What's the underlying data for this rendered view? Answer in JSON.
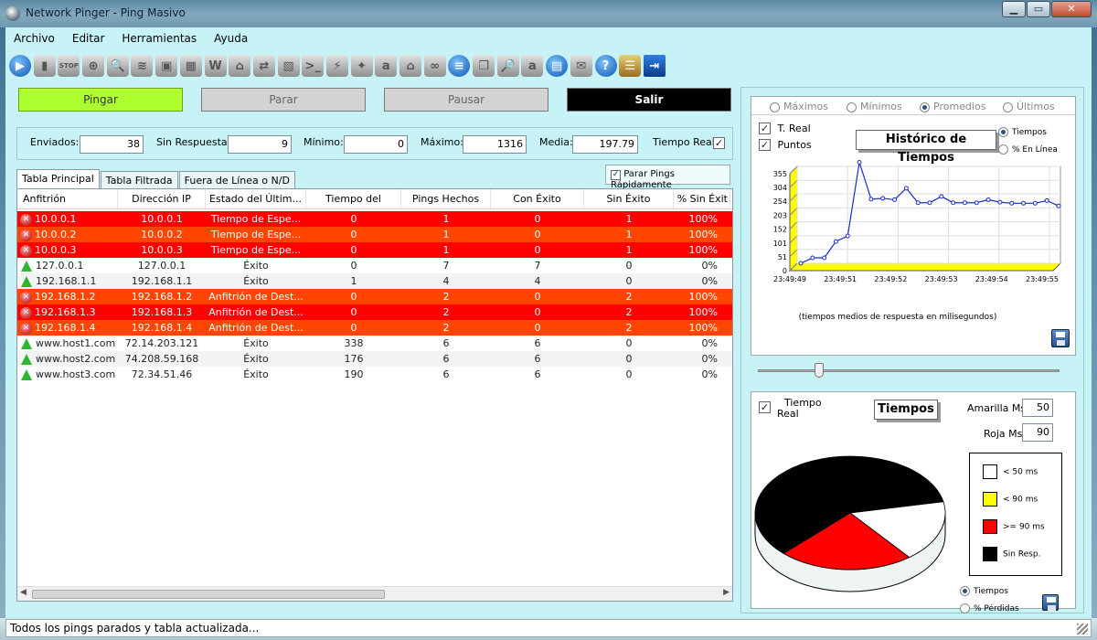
{
  "window": {
    "title": "Network Pinger - Ping Masivo",
    "min": "▁",
    "max": "▭",
    "close": "✕"
  },
  "menu": [
    "Archivo",
    "Editar",
    "Herramientas",
    "Ayuda"
  ],
  "toolbar": [
    {
      "name": "play-icon",
      "style": "blue",
      "glyph": "▶"
    },
    {
      "name": "phone-icon",
      "style": "grey",
      "glyph": "▮"
    },
    {
      "name": "stop-icon",
      "style": "grey",
      "glyph": "STOP"
    },
    {
      "name": "target-icon",
      "style": "grey",
      "glyph": "⊕"
    },
    {
      "name": "magnifier-icon",
      "style": "grey",
      "glyph": "🔍"
    },
    {
      "name": "ip-scan-icon",
      "style": "grey",
      "glyph": "≋"
    },
    {
      "name": "picture-icon",
      "style": "grey",
      "glyph": "▣"
    },
    {
      "name": "grid-icon",
      "style": "grey",
      "glyph": "▦"
    },
    {
      "name": "wifi-icon",
      "style": "grey",
      "glyph": "W"
    },
    {
      "name": "factory-icon",
      "style": "grey",
      "glyph": "⌂"
    },
    {
      "name": "network-icon",
      "style": "grey",
      "glyph": "⇄"
    },
    {
      "name": "map-icon",
      "style": "grey",
      "glyph": "▧"
    },
    {
      "name": "terminal-icon",
      "style": "grey",
      "glyph": ">_"
    },
    {
      "name": "cable-icon",
      "style": "grey",
      "glyph": "⚡"
    },
    {
      "name": "flashlight-icon",
      "style": "grey",
      "glyph": "✦"
    },
    {
      "name": "amazon-icon",
      "style": "grey",
      "glyph": "a"
    },
    {
      "name": "bank-icon",
      "style": "grey",
      "glyph": "⌂"
    },
    {
      "name": "link-icon",
      "style": "grey",
      "glyph": "∞"
    },
    {
      "name": "server-icon",
      "style": "blue",
      "glyph": "≡"
    },
    {
      "name": "copy-icon",
      "style": "grey",
      "glyph": "❐"
    },
    {
      "name": "search-doc-icon",
      "style": "grey",
      "glyph": "🔎"
    },
    {
      "name": "font-icon",
      "style": "grey",
      "glyph": "a"
    },
    {
      "name": "save-icon",
      "style": "blue",
      "glyph": "▤"
    },
    {
      "name": "mailbox-icon",
      "style": "grey",
      "glyph": "✉"
    },
    {
      "name": "help-icon",
      "style": "blue",
      "glyph": "?"
    },
    {
      "name": "notes-icon",
      "style": "note",
      "glyph": "☰"
    },
    {
      "name": "exit-door-icon",
      "style": "door",
      "glyph": "⇥"
    }
  ],
  "buttons": {
    "ping": "Pingar",
    "stop": "Parar",
    "pause": "Pausar",
    "exit": "Salir"
  },
  "stats": {
    "sent_label": "Enviados:",
    "sent": "38",
    "noresp_label": "Sin Respuesta:",
    "noresp": "9",
    "min_label": "Mínimo:",
    "min": "0",
    "max_label": "Máximo:",
    "max": "1316",
    "avg_label": "Media:",
    "avg": "197.79",
    "realtime_label": "Tiempo Real"
  },
  "tabs": [
    "Tabla Principal",
    "Tabla Filtrada",
    "Fuera de Línea o N/D"
  ],
  "fast_stop_label": "Parar Pings Rápidamente",
  "table": {
    "headers": [
      "Anfitrión",
      "Dirección IP",
      "Estado del Últim...",
      "Tiempo del Últim...",
      "Pings Hechos",
      "Con Éxito",
      "Sin Éxito",
      "% Sin Éxit"
    ],
    "rows": [
      {
        "style": "red",
        "icon": "err",
        "host": "10.0.0.1",
        "ip": "10.0.0.1",
        "status": "Tiempo de Espe...",
        "time": "0",
        "done": "1",
        "ok": "0",
        "fail": "1",
        "pct": "100%"
      },
      {
        "style": "orange",
        "icon": "err",
        "host": "10.0.0.2",
        "ip": "10.0.0.2",
        "status": "Tiempo de Espe...",
        "time": "0",
        "done": "1",
        "ok": "0",
        "fail": "1",
        "pct": "100%"
      },
      {
        "style": "red",
        "icon": "err",
        "host": "10.0.0.3",
        "ip": "10.0.0.3",
        "status": "Tiempo de Espe...",
        "time": "0",
        "done": "1",
        "ok": "0",
        "fail": "1",
        "pct": "100%"
      },
      {
        "style": "white",
        "icon": "ok",
        "host": "127.0.0.1",
        "ip": "127.0.0.1",
        "status": "Éxito",
        "time": "0",
        "done": "7",
        "ok": "7",
        "fail": "0",
        "pct": "0%"
      },
      {
        "style": "alt",
        "icon": "ok",
        "host": "192.168.1.1",
        "ip": "192.168.1.1",
        "status": "Éxito",
        "time": "1",
        "done": "4",
        "ok": "4",
        "fail": "0",
        "pct": "0%"
      },
      {
        "style": "orange",
        "icon": "err",
        "host": "192.168.1.2",
        "ip": "192.168.1.2",
        "status": "Anfitrión de Dest...",
        "time": "0",
        "done": "2",
        "ok": "0",
        "fail": "2",
        "pct": "100%"
      },
      {
        "style": "red",
        "icon": "err",
        "host": "192.168.1.3",
        "ip": "192.168.1.3",
        "status": "Anfitrión de Dest...",
        "time": "0",
        "done": "2",
        "ok": "0",
        "fail": "2",
        "pct": "100%"
      },
      {
        "style": "orange",
        "icon": "err",
        "host": "192.168.1.4",
        "ip": "192.168.1.4",
        "status": "Anfitrión de Dest...",
        "time": "0",
        "done": "2",
        "ok": "0",
        "fail": "2",
        "pct": "100%"
      },
      {
        "style": "white",
        "icon": "ok",
        "host": "www.host1.com",
        "ip": "72.14.203.121",
        "status": "Éxito",
        "time": "338",
        "done": "6",
        "ok": "6",
        "fail": "0",
        "pct": "0%"
      },
      {
        "style": "alt",
        "icon": "ok",
        "host": "www.host2.com",
        "ip": "74.208.59.168",
        "status": "Éxito",
        "time": "176",
        "done": "6",
        "ok": "6",
        "fail": "0",
        "pct": "0%"
      },
      {
        "style": "white",
        "icon": "ok",
        "host": "www.host3.com",
        "ip": "72.34.51.46",
        "status": "Éxito",
        "time": "190",
        "done": "6",
        "ok": "6",
        "fail": "0",
        "pct": "0%"
      }
    ]
  },
  "history": {
    "radios": [
      "Máximos",
      "Mínimos",
      "Promedios",
      "Últimos"
    ],
    "selected_radio": "Promedios",
    "treal_label": "T. Real",
    "points_label": "Puntos",
    "title": "Histórico de Tiempos",
    "mode_radios": [
      "Tiempos",
      "% En Línea"
    ],
    "selected_mode": "Tiempos",
    "caption": "(tiempos medios de respuesta en milisegundos)"
  },
  "pie": {
    "realtime_label_1": "Tiempo",
    "realtime_label_2": "Real",
    "title": "Tiempos",
    "yellow_label": "Amarilla Ms",
    "yellow_value": "50",
    "red_label": "Roja Ms",
    "red_value": "90",
    "legend": [
      {
        "label": "< 50 ms",
        "color": "#ffffff"
      },
      {
        "label": "< 90 ms",
        "color": "#ffff00"
      },
      {
        "label": ">= 90 ms",
        "color": "#ff0000"
      },
      {
        "label": "Sin Resp.",
        "color": "#000000"
      }
    ],
    "mode_radios": [
      "Tiempos",
      "% Pérdidas"
    ],
    "selected_mode": "Tiempos"
  },
  "chart_data": [
    {
      "type": "line",
      "title": "Histórico de Tiempos",
      "xlabel": "(tiempos medios de respuesta en milisegundos)",
      "ylabel": "",
      "yticks": [
        0,
        51,
        101,
        152,
        203,
        254,
        304,
        355
      ],
      "ylim": [
        0,
        355
      ],
      "xtick_labels": [
        "23:49:49",
        "23:49:51",
        "23:49:52",
        "23:49:53",
        "23:49:54",
        "23:49:55"
      ],
      "series": [
        {
          "values": [
            0,
            20,
            20,
            80,
            100,
            370,
            235,
            238,
            233,
            275,
            222,
            222,
            245,
            222,
            222,
            222,
            233,
            224,
            220,
            220,
            220,
            230,
            210
          ],
          "color": "#1a2cc8"
        }
      ]
    },
    {
      "type": "pie",
      "title": "Tiempos",
      "labels": [
        "< 50 ms",
        "< 90 ms",
        ">= 90 ms",
        "Sin Resp."
      ],
      "values": [
        17.5,
        0,
        23.0,
        59.5
      ],
      "colors": [
        "#ffffff",
        "#ffff00",
        "#ff0000",
        "#000000"
      ]
    }
  ],
  "status_text": "Todos los pings parados y tabla actualizada..."
}
